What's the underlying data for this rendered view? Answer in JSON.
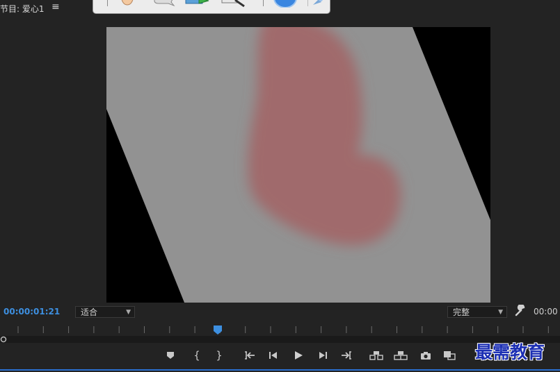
{
  "panel": {
    "title": "节目: 爱心1",
    "menu_icon": "hamburger-menu-icon"
  },
  "toolbar": {
    "icons": [
      "hand-icon",
      "speech-bubble-icon",
      "export-arrow-icon",
      "magnifier-icon",
      "globe-icon",
      "pin-icon"
    ]
  },
  "controls": {
    "timecode": "00:00:01:21",
    "fit_selected": "适合",
    "quality_selected": "完整",
    "timecode_right": "00:00"
  },
  "transport": {
    "buttons": [
      "marker-icon",
      "mark-in-icon",
      "mark-out-icon",
      "go-to-in-icon",
      "step-back-icon",
      "play-icon",
      "step-forward-icon",
      "go-to-out-icon",
      "insert-icon",
      "overwrite-icon",
      "camera-icon",
      "compare-icon"
    ]
  },
  "watermark": {
    "text": "最需教育"
  },
  "colors": {
    "accent": "#3d8fe0",
    "background": "#232323",
    "frame_gray": "#929292",
    "shape_red": "#a06a6c"
  }
}
